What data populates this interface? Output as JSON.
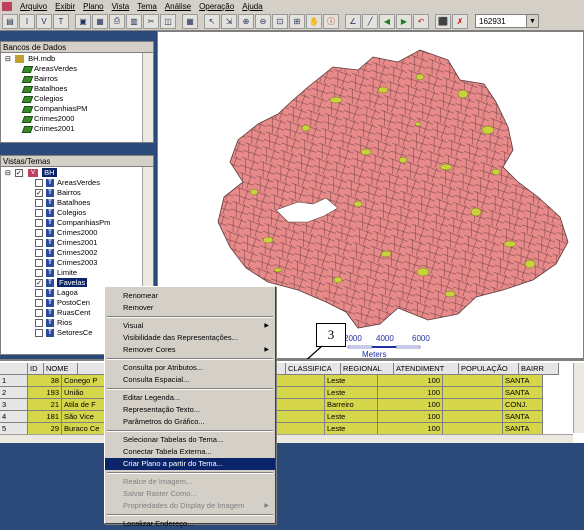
{
  "menu": [
    "Arquivo",
    "Exibir",
    "Plano",
    "Vista",
    "Tema",
    "Análise",
    "Operação",
    "Ajuda"
  ],
  "toolbar": {
    "scale_value": "162931"
  },
  "banco_panel": {
    "title": "Bancos de Dados",
    "db_name": "BH.mdb",
    "items": [
      "AreasVerdes",
      "Bairros",
      "Batalhoes",
      "Colegios",
      "CompanhiasPM",
      "Crimes2000",
      "Crimes2001"
    ]
  },
  "vistas_panel": {
    "title": "Vistas/Temas",
    "vista_name": "BH",
    "themes": [
      {
        "name": "AreasVerdes",
        "checked": false
      },
      {
        "name": "Bairros",
        "checked": true
      },
      {
        "name": "Batalhoes",
        "checked": false
      },
      {
        "name": "Colegios",
        "checked": false
      },
      {
        "name": "CompanhiasPm",
        "checked": false
      },
      {
        "name": "Crimes2000",
        "checked": false
      },
      {
        "name": "Crimes2001",
        "checked": false
      },
      {
        "name": "Crimes2002",
        "checked": false
      },
      {
        "name": "Crimes2003",
        "checked": false
      },
      {
        "name": "Limite",
        "checked": false
      },
      {
        "name": "Favelas",
        "checked": true
      },
      {
        "name": "Lagoa",
        "checked": false
      },
      {
        "name": "PostoCen",
        "checked": false
      },
      {
        "name": "RuasCent",
        "checked": false
      },
      {
        "name": "Rios",
        "checked": false
      },
      {
        "name": "SetoresCe",
        "checked": false
      }
    ]
  },
  "map": {
    "colors": {
      "fill": "#e8898a",
      "green": "#c8d23a",
      "water": "#ffffff",
      "border": "#5a3a3a"
    },
    "scale_ticks": [
      "2000",
      "4000",
      "6000"
    ],
    "scale_unit": "Meters"
  },
  "callout": "3",
  "table": {
    "headers": [
      "ID",
      "NOME",
      "",
      "CLASSIFICA",
      "REGIONAL",
      "ATENDIMENT",
      "POPULAÇÃO",
      "BAIRR"
    ],
    "rows": [
      {
        "n": "1",
        "id": "38",
        "nome": "Conego P",
        "regional": "Leste",
        "atend": "100",
        "bairro": "SANTA"
      },
      {
        "n": "2",
        "id": "193",
        "nome": "União",
        "regional": "Leste",
        "atend": "100",
        "bairro": "SANTA"
      },
      {
        "n": "3",
        "id": "21",
        "nome": "Atila de F",
        "regional": "Barreiro",
        "atend": "100",
        "bairro": "CONJ."
      },
      {
        "n": "4",
        "id": "181",
        "nome": "São Vice",
        "regional": "Leste",
        "atend": "100",
        "bairro": "SANTA"
      },
      {
        "n": "5",
        "id": "29",
        "nome": "Buraco Ce",
        "regional": "Leste",
        "atend": "100",
        "bairro": "SANTA"
      }
    ]
  },
  "context_menu": [
    {
      "label": "Renomear",
      "disabled": false,
      "sub": false
    },
    {
      "label": "Remover",
      "disabled": false,
      "sub": false
    },
    {
      "sep": true
    },
    {
      "label": "Visual",
      "disabled": false,
      "sub": true
    },
    {
      "label": "Visibilidade das Representações...",
      "disabled": false,
      "sub": false
    },
    {
      "label": "Remover Cores",
      "disabled": false,
      "sub": true
    },
    {
      "sep": true
    },
    {
      "label": "Consulta por Atributos...",
      "disabled": false,
      "sub": false
    },
    {
      "label": "Consulta Espacial...",
      "disabled": false,
      "sub": false
    },
    {
      "sep": true
    },
    {
      "label": "Editar Legenda...",
      "disabled": false,
      "sub": false
    },
    {
      "label": "Representação Texto...",
      "disabled": false,
      "sub": false
    },
    {
      "label": "Parâmetros do Gráfico...",
      "disabled": false,
      "sub": false
    },
    {
      "sep": true
    },
    {
      "label": "Selecionar Tabelas do Tema...",
      "disabled": false,
      "sub": false
    },
    {
      "label": "Conectar Tabela Externa...",
      "disabled": false,
      "sub": false
    },
    {
      "label": "Criar Plano a partir do Tema...",
      "disabled": false,
      "sub": false,
      "highlight": true
    },
    {
      "sep": true
    },
    {
      "label": "Realce de Imagem...",
      "disabled": true,
      "sub": false
    },
    {
      "label": "Salvar Raster Como...",
      "disabled": true,
      "sub": false
    },
    {
      "label": "Propriedades do Display de Imagem",
      "disabled": true,
      "sub": true
    },
    {
      "sep": true
    },
    {
      "label": "Localizar Endereço...",
      "disabled": false,
      "sub": false
    }
  ]
}
